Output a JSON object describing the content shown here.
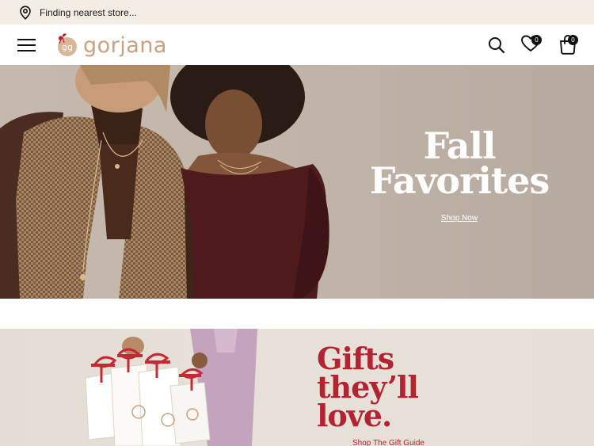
{
  "store_bar": {
    "icon": "location-pin-icon",
    "text": "Finding nearest store..."
  },
  "header": {
    "menu_icon": "hamburger-menu-icon",
    "logo_text": "gorjana",
    "logo_mark_text": "gg",
    "search_icon": "search-icon",
    "wishlist_icon": "heart-icon",
    "wishlist_count": "0",
    "bag_icon": "shopping-bag-icon",
    "bag_count": "0"
  },
  "hero": {
    "title": "Fall\nFavorites",
    "cta": "Shop Now"
  },
  "gift_banner": {
    "title": "Gifts\nthey’ll\nlove.",
    "cta": "Shop The Gift Guide"
  },
  "colors": {
    "store_bar_bg": "#f3ede4",
    "brand_tan": "#c9a17e",
    "gift_red": "#b42331"
  }
}
